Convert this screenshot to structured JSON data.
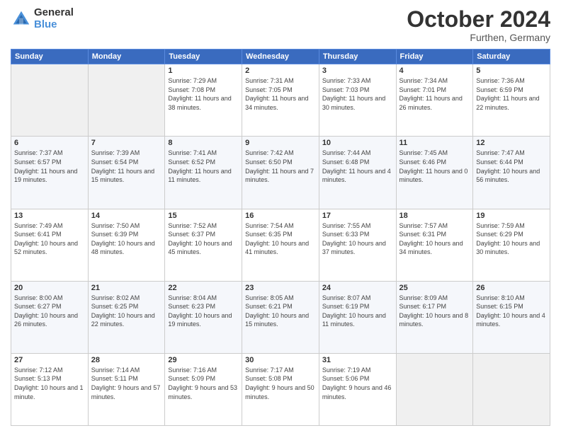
{
  "header": {
    "logo_general": "General",
    "logo_blue": "Blue",
    "month_title": "October 2024",
    "location": "Furthen, Germany"
  },
  "days_of_week": [
    "Sunday",
    "Monday",
    "Tuesday",
    "Wednesday",
    "Thursday",
    "Friday",
    "Saturday"
  ],
  "weeks": [
    [
      {
        "day": "",
        "info": ""
      },
      {
        "day": "",
        "info": ""
      },
      {
        "day": "1",
        "info": "Sunrise: 7:29 AM\nSunset: 7:08 PM\nDaylight: 11 hours and 38 minutes."
      },
      {
        "day": "2",
        "info": "Sunrise: 7:31 AM\nSunset: 7:05 PM\nDaylight: 11 hours and 34 minutes."
      },
      {
        "day": "3",
        "info": "Sunrise: 7:33 AM\nSunset: 7:03 PM\nDaylight: 11 hours and 30 minutes."
      },
      {
        "day": "4",
        "info": "Sunrise: 7:34 AM\nSunset: 7:01 PM\nDaylight: 11 hours and 26 minutes."
      },
      {
        "day": "5",
        "info": "Sunrise: 7:36 AM\nSunset: 6:59 PM\nDaylight: 11 hours and 22 minutes."
      }
    ],
    [
      {
        "day": "6",
        "info": "Sunrise: 7:37 AM\nSunset: 6:57 PM\nDaylight: 11 hours and 19 minutes."
      },
      {
        "day": "7",
        "info": "Sunrise: 7:39 AM\nSunset: 6:54 PM\nDaylight: 11 hours and 15 minutes."
      },
      {
        "day": "8",
        "info": "Sunrise: 7:41 AM\nSunset: 6:52 PM\nDaylight: 11 hours and 11 minutes."
      },
      {
        "day": "9",
        "info": "Sunrise: 7:42 AM\nSunset: 6:50 PM\nDaylight: 11 hours and 7 minutes."
      },
      {
        "day": "10",
        "info": "Sunrise: 7:44 AM\nSunset: 6:48 PM\nDaylight: 11 hours and 4 minutes."
      },
      {
        "day": "11",
        "info": "Sunrise: 7:45 AM\nSunset: 6:46 PM\nDaylight: 11 hours and 0 minutes."
      },
      {
        "day": "12",
        "info": "Sunrise: 7:47 AM\nSunset: 6:44 PM\nDaylight: 10 hours and 56 minutes."
      }
    ],
    [
      {
        "day": "13",
        "info": "Sunrise: 7:49 AM\nSunset: 6:41 PM\nDaylight: 10 hours and 52 minutes."
      },
      {
        "day": "14",
        "info": "Sunrise: 7:50 AM\nSunset: 6:39 PM\nDaylight: 10 hours and 48 minutes."
      },
      {
        "day": "15",
        "info": "Sunrise: 7:52 AM\nSunset: 6:37 PM\nDaylight: 10 hours and 45 minutes."
      },
      {
        "day": "16",
        "info": "Sunrise: 7:54 AM\nSunset: 6:35 PM\nDaylight: 10 hours and 41 minutes."
      },
      {
        "day": "17",
        "info": "Sunrise: 7:55 AM\nSunset: 6:33 PM\nDaylight: 10 hours and 37 minutes."
      },
      {
        "day": "18",
        "info": "Sunrise: 7:57 AM\nSunset: 6:31 PM\nDaylight: 10 hours and 34 minutes."
      },
      {
        "day": "19",
        "info": "Sunrise: 7:59 AM\nSunset: 6:29 PM\nDaylight: 10 hours and 30 minutes."
      }
    ],
    [
      {
        "day": "20",
        "info": "Sunrise: 8:00 AM\nSunset: 6:27 PM\nDaylight: 10 hours and 26 minutes."
      },
      {
        "day": "21",
        "info": "Sunrise: 8:02 AM\nSunset: 6:25 PM\nDaylight: 10 hours and 22 minutes."
      },
      {
        "day": "22",
        "info": "Sunrise: 8:04 AM\nSunset: 6:23 PM\nDaylight: 10 hours and 19 minutes."
      },
      {
        "day": "23",
        "info": "Sunrise: 8:05 AM\nSunset: 6:21 PM\nDaylight: 10 hours and 15 minutes."
      },
      {
        "day": "24",
        "info": "Sunrise: 8:07 AM\nSunset: 6:19 PM\nDaylight: 10 hours and 11 minutes."
      },
      {
        "day": "25",
        "info": "Sunrise: 8:09 AM\nSunset: 6:17 PM\nDaylight: 10 hours and 8 minutes."
      },
      {
        "day": "26",
        "info": "Sunrise: 8:10 AM\nSunset: 6:15 PM\nDaylight: 10 hours and 4 minutes."
      }
    ],
    [
      {
        "day": "27",
        "info": "Sunrise: 7:12 AM\nSunset: 5:13 PM\nDaylight: 10 hours and 1 minute."
      },
      {
        "day": "28",
        "info": "Sunrise: 7:14 AM\nSunset: 5:11 PM\nDaylight: 9 hours and 57 minutes."
      },
      {
        "day": "29",
        "info": "Sunrise: 7:16 AM\nSunset: 5:09 PM\nDaylight: 9 hours and 53 minutes."
      },
      {
        "day": "30",
        "info": "Sunrise: 7:17 AM\nSunset: 5:08 PM\nDaylight: 9 hours and 50 minutes."
      },
      {
        "day": "31",
        "info": "Sunrise: 7:19 AM\nSunset: 5:06 PM\nDaylight: 9 hours and 46 minutes."
      },
      {
        "day": "",
        "info": ""
      },
      {
        "day": "",
        "info": ""
      }
    ]
  ]
}
